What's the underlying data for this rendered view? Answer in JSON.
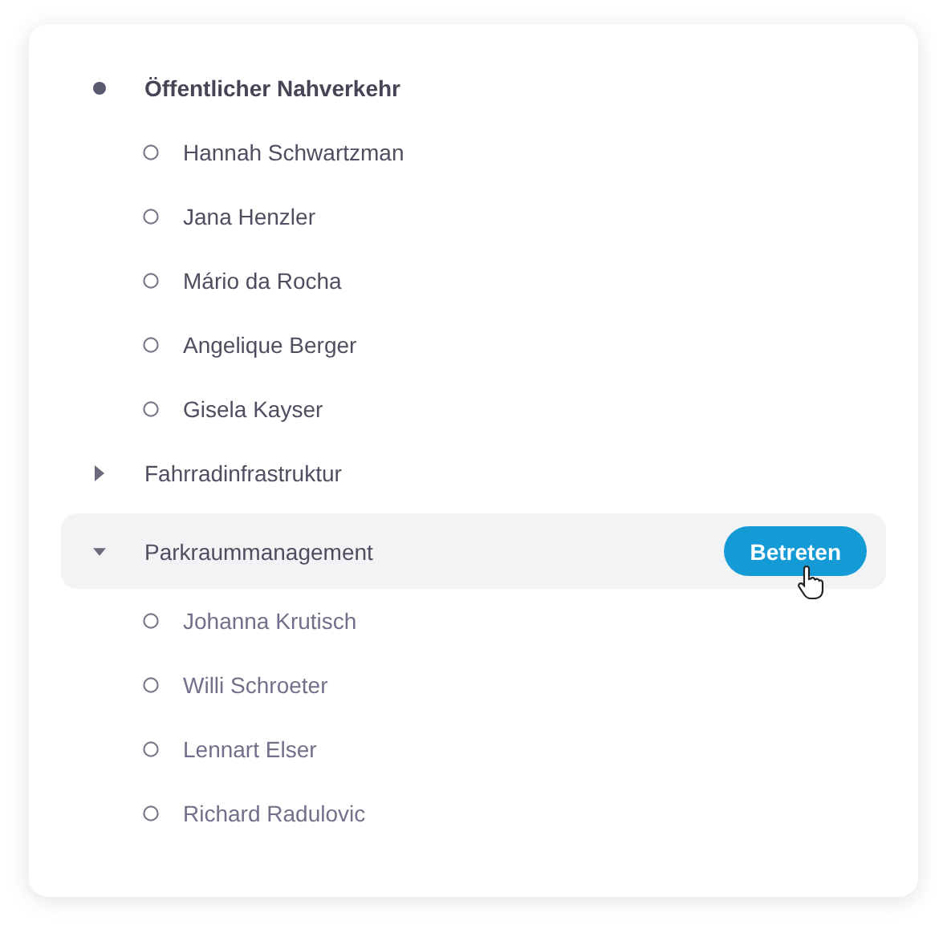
{
  "tree": [
    {
      "title": "Öffentlicher Nahverkehr",
      "kind": "dot",
      "active": true,
      "expanded": true,
      "selected": false,
      "children": [
        {
          "name": "Hannah Schwartzman"
        },
        {
          "name": "Jana Henzler"
        },
        {
          "name": "Mário da Rocha"
        },
        {
          "name": "Angelique Berger"
        },
        {
          "name": "Gisela Kayser"
        }
      ]
    },
    {
      "title": "Fahrradinfrastruktur",
      "kind": "arrow",
      "active": false,
      "expanded": false,
      "selected": false
    },
    {
      "title": "Parkraummanagement",
      "kind": "arrow",
      "active": false,
      "expanded": true,
      "selected": true,
      "action": "Betreten",
      "children": [
        {
          "name": "Johanna Krutisch"
        },
        {
          "name": "Willi Schroeter"
        },
        {
          "name": "Lennart Elser"
        },
        {
          "name": "Richard Radulovic"
        }
      ]
    }
  ]
}
